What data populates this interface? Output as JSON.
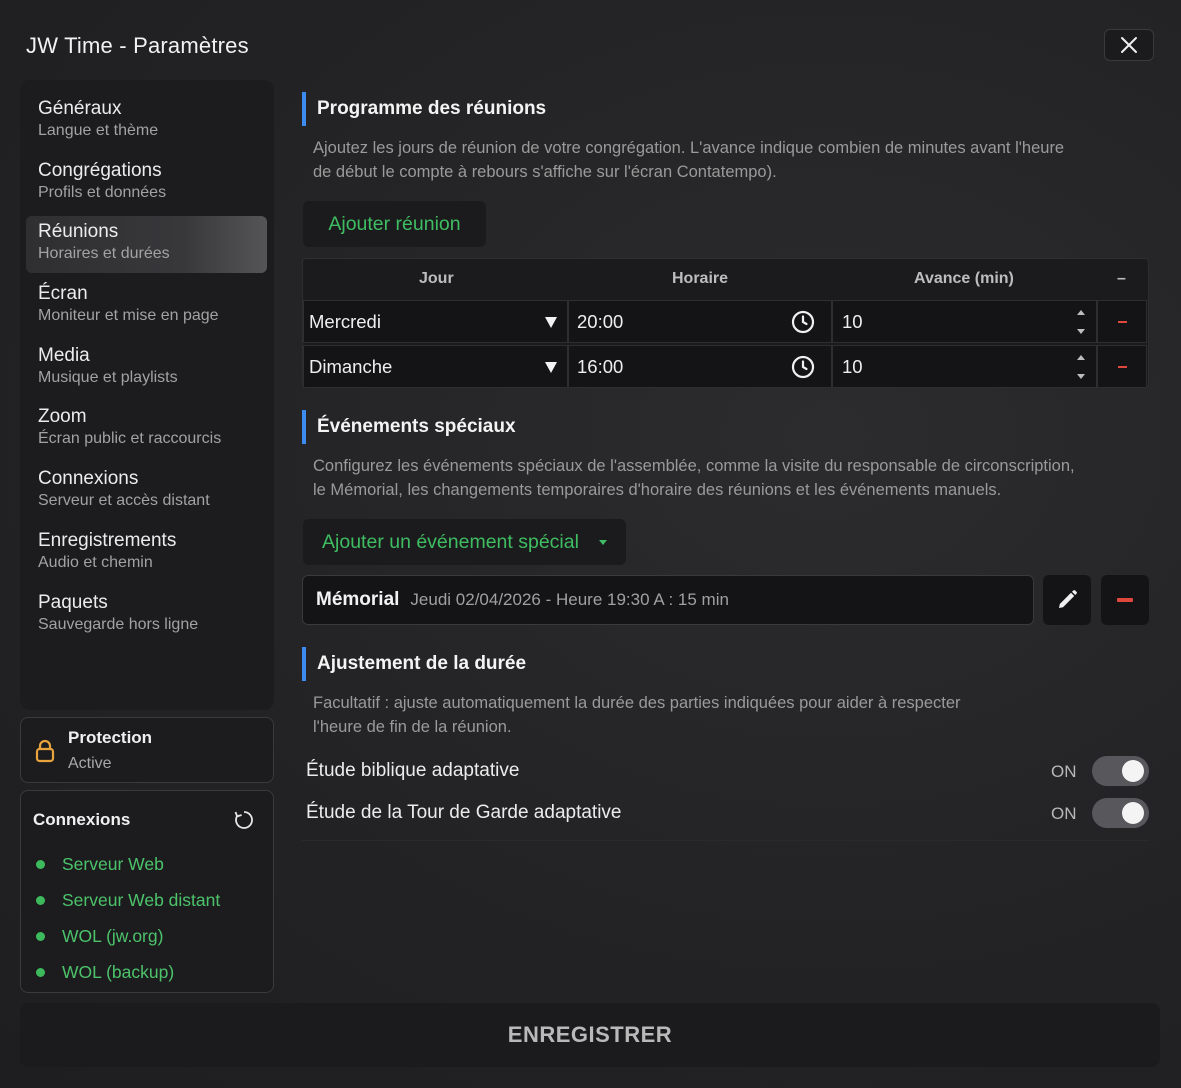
{
  "window": {
    "title": "JW Time - Paramètres",
    "close_icon": "close-icon"
  },
  "sidebar": {
    "items": [
      {
        "label": "Généraux",
        "sub": "Langue et thème",
        "active": false
      },
      {
        "label": "Congrégations",
        "sub": "Profils et données",
        "active": false
      },
      {
        "label": "Réunions",
        "sub": "Horaires et durées",
        "active": true
      },
      {
        "label": "Écran",
        "sub": "Moniteur et mise en page",
        "active": false
      },
      {
        "label": "Media",
        "sub": "Musique et playlists",
        "active": false
      },
      {
        "label": "Zoom",
        "sub": "Écran public et raccourcis",
        "active": false
      },
      {
        "label": "Connexions",
        "sub": "Serveur et accès distant",
        "active": false
      },
      {
        "label": "Enregistrements",
        "sub": "Audio et chemin",
        "active": false
      },
      {
        "label": "Paquets",
        "sub": "Sauvegarde hors ligne",
        "active": false
      }
    ]
  },
  "protection": {
    "title": "Protection",
    "status": "Active",
    "icon": "lock-icon",
    "icon_color": "#e8a33d"
  },
  "connections": {
    "title": "Connexions",
    "items": [
      {
        "label": "Serveur Web",
        "status_color": "#3dbb5c"
      },
      {
        "label": "Serveur Web distant",
        "status_color": "#3dbb5c"
      },
      {
        "label": "WOL (jw.org)",
        "status_color": "#3dbb5c"
      },
      {
        "label": "WOL (backup)",
        "status_color": "#3dbb5c"
      }
    ]
  },
  "meetings": {
    "title": "Programme des réunions",
    "desc1": "Ajoutez les jours de réunion de votre congrégation. L'avance indique combien de minutes avant l'heure",
    "desc2": "de début le compte à rebours s'affiche sur l'écran Contatempo).",
    "add_label": "Ajouter réunion",
    "columns": {
      "day": "Jour",
      "time": "Horaire",
      "advance": "Avance (min)",
      "action": "–"
    },
    "rows": [
      {
        "day": "Mercredi",
        "time": "20:00",
        "advance": "10",
        "remove": "–"
      },
      {
        "day": "Dimanche",
        "time": "16:00",
        "advance": "10",
        "remove": "–"
      }
    ]
  },
  "special_events": {
    "title": "Événements spéciaux",
    "desc1": "Configurez les événements spéciaux de l'assemblée, comme la visite du responsable de circonscription,",
    "desc2": "le Mémorial, les changements temporaires d'horaire des réunions et les événements manuels.",
    "add_label": "Ajouter un événement spécial",
    "events": [
      {
        "name": "Mémorial",
        "detail": "Jeudi 02/04/2026 - Heure 19:30 A : 15 min"
      }
    ]
  },
  "duration": {
    "title": "Ajustement de la durée",
    "desc1": "Facultatif : ajuste automatiquement la durée des parties indiquées pour aider à respecter",
    "desc2": "l'heure de fin de la réunion.",
    "toggles": [
      {
        "label": "Étude biblique adaptative",
        "state": "ON",
        "on": true
      },
      {
        "label": "Étude de la Tour de Garde adaptative",
        "state": "ON",
        "on": true
      }
    ]
  },
  "save_label": "ENREGISTRER",
  "colors": {
    "accent_blue": "#3d8bf0",
    "green": "#3fbd62",
    "danger": "#e0483d"
  }
}
